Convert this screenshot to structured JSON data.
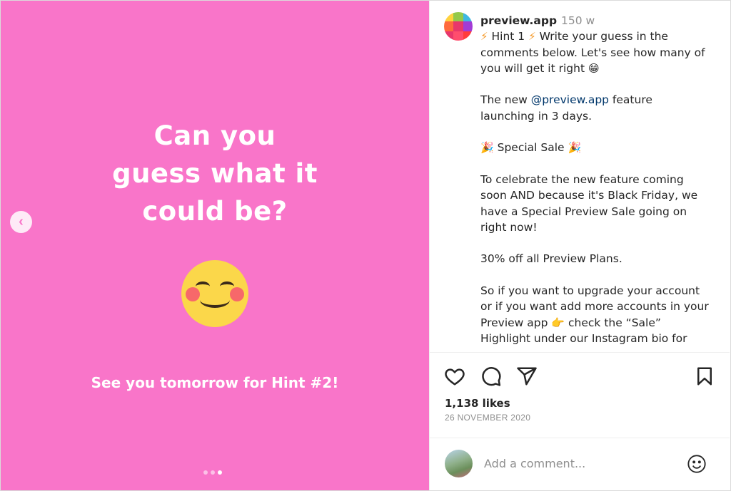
{
  "post": {
    "headline_lines": [
      "Can you",
      "guess what it",
      "could be?"
    ],
    "subline": "See you tomorrow for Hint #2!",
    "prev_button_glyph": "‹",
    "background_color": "#f975c9",
    "carousel": {
      "count": 3,
      "active_index": 3
    }
  },
  "author": {
    "username": "preview.app",
    "time_ago": "150 w",
    "logo_colors": [
      "#ffd23f",
      "#93c94b",
      "#3fb8e2",
      "#ff6a3d",
      "#e8376b",
      "#a23bd6",
      "#e8376b",
      "#ff4d6d",
      "#ff3b3b"
    ]
  },
  "caption": {
    "intro": "Hint 1",
    "intro_rest": "Write your guess in the comments below. Let's see how many of you will get it right",
    "intro_emoji": "😁",
    "bolt_glyph": "⚡",
    "p2_before": "The new ",
    "mention": "@preview.app",
    "p2_after": " feature launching in 3 days.",
    "party_glyph": "🎉",
    "sale_title": "Special Sale",
    "p4": "To celebrate the new feature coming soon AND because it's Black Friday, we have a Special Preview Sale going on right now!",
    "p5": "30% off all Preview Plans.",
    "p6_before": "So if you want to upgrade your account or if you want add more accounts in your Preview app",
    "point_glyph": "👉",
    "p6_after": "check the “Sale” Highlight under our Instagram bio for"
  },
  "actions": {
    "icons": [
      "heart-icon",
      "comment-icon",
      "share-icon",
      "bookmark-icon"
    ],
    "likes": "1,138 likes",
    "date": "26 NOVEMBER 2020"
  },
  "comment": {
    "placeholder": "Add a comment..."
  }
}
